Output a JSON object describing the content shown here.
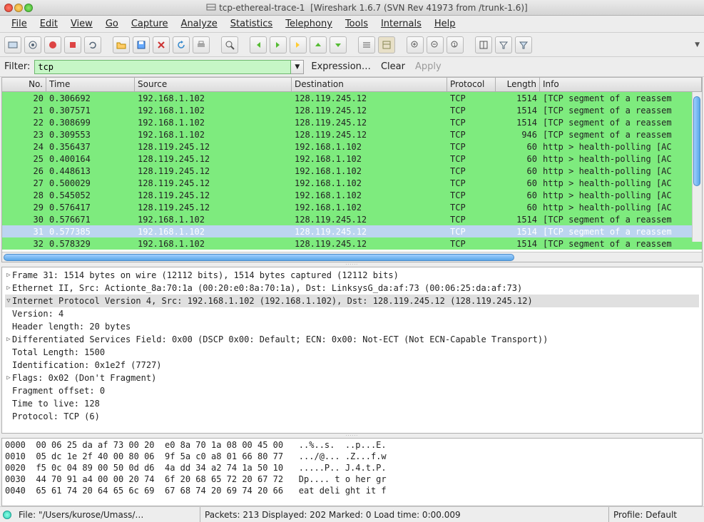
{
  "window": {
    "title_doc": "tcp-ethereal-trace-1",
    "title_app": "[Wireshark 1.6.7  (SVN Rev 41973 from /trunk-1.6)]"
  },
  "menu": {
    "file": "File",
    "edit": "Edit",
    "view": "View",
    "go": "Go",
    "capture": "Capture",
    "analyze": "Analyze",
    "statistics": "Statistics",
    "telephony": "Telephony",
    "tools": "Tools",
    "internals": "Internals",
    "help": "Help"
  },
  "filter": {
    "label": "Filter:",
    "value": "tcp",
    "expression": "Expression…",
    "clear": "Clear",
    "apply": "Apply"
  },
  "columns": {
    "no": "No.",
    "time": "Time",
    "source": "Source",
    "destination": "Destination",
    "protocol": "Protocol",
    "length": "Length",
    "info": "Info"
  },
  "packets": [
    {
      "no": "20",
      "time": "0.306692",
      "src": "192.168.1.102",
      "dst": "128.119.245.12",
      "proto": "TCP",
      "len": "1514",
      "info": "[TCP segment of a reassem",
      "sel": false
    },
    {
      "no": "21",
      "time": "0.307571",
      "src": "192.168.1.102",
      "dst": "128.119.245.12",
      "proto": "TCP",
      "len": "1514",
      "info": "[TCP segment of a reassem",
      "sel": false
    },
    {
      "no": "22",
      "time": "0.308699",
      "src": "192.168.1.102",
      "dst": "128.119.245.12",
      "proto": "TCP",
      "len": "1514",
      "info": "[TCP segment of a reassem",
      "sel": false
    },
    {
      "no": "23",
      "time": "0.309553",
      "src": "192.168.1.102",
      "dst": "128.119.245.12",
      "proto": "TCP",
      "len": "946",
      "info": "[TCP segment of a reassem",
      "sel": false
    },
    {
      "no": "24",
      "time": "0.356437",
      "src": "128.119.245.12",
      "dst": "192.168.1.102",
      "proto": "TCP",
      "len": "60",
      "info": "http > health-polling [AC",
      "sel": false
    },
    {
      "no": "25",
      "time": "0.400164",
      "src": "128.119.245.12",
      "dst": "192.168.1.102",
      "proto": "TCP",
      "len": "60",
      "info": "http > health-polling [AC",
      "sel": false
    },
    {
      "no": "26",
      "time": "0.448613",
      "src": "128.119.245.12",
      "dst": "192.168.1.102",
      "proto": "TCP",
      "len": "60",
      "info": "http > health-polling [AC",
      "sel": false
    },
    {
      "no": "27",
      "time": "0.500029",
      "src": "128.119.245.12",
      "dst": "192.168.1.102",
      "proto": "TCP",
      "len": "60",
      "info": "http > health-polling [AC",
      "sel": false
    },
    {
      "no": "28",
      "time": "0.545052",
      "src": "128.119.245.12",
      "dst": "192.168.1.102",
      "proto": "TCP",
      "len": "60",
      "info": "http > health-polling [AC",
      "sel": false
    },
    {
      "no": "29",
      "time": "0.576417",
      "src": "128.119.245.12",
      "dst": "192.168.1.102",
      "proto": "TCP",
      "len": "60",
      "info": "http > health-polling [AC",
      "sel": false
    },
    {
      "no": "30",
      "time": "0.576671",
      "src": "192.168.1.102",
      "dst": "128.119.245.12",
      "proto": "TCP",
      "len": "1514",
      "info": "[TCP segment of a reassem",
      "sel": false
    },
    {
      "no": "31",
      "time": "0.577385",
      "src": "192.168.1.102",
      "dst": "128.119.245.12",
      "proto": "TCP",
      "len": "1514",
      "info": "[TCP segment of a reassem",
      "sel": true
    },
    {
      "no": "32",
      "time": "0.578329",
      "src": "192.168.1.102",
      "dst": "128.119.245.12",
      "proto": "TCP",
      "len": "1514",
      "info": "[TCP segment of a reassem",
      "sel": false
    }
  ],
  "details": {
    "frame": "Frame 31: 1514 bytes on wire (12112 bits), 1514 bytes captured (12112 bits)",
    "eth": "Ethernet II, Src: Actionte_8a:70:1a (00:20:e0:8a:70:1a), Dst: LinksysG_da:af:73 (00:06:25:da:af:73)",
    "ip": "Internet Protocol Version 4, Src: 192.168.1.102 (192.168.1.102), Dst: 128.119.245.12 (128.119.245.12)",
    "ip_children": [
      "Version: 4",
      "Header length: 20 bytes",
      "Differentiated Services Field: 0x00 (DSCP 0x00: Default; ECN: 0x00: Not-ECT (Not ECN-Capable Transport))",
      "Total Length: 1500",
      "Identification: 0x1e2f (7727)",
      "Flags: 0x02 (Don't Fragment)",
      "Fragment offset: 0",
      "Time to live: 128",
      "Protocol: TCP (6)"
    ]
  },
  "hex": [
    "0000  00 06 25 da af 73 00 20  e0 8a 70 1a 08 00 45 00   ..%..s.  ..p...E.",
    "0010  05 dc 1e 2f 40 00 80 06  9f 5a c0 a8 01 66 80 77   .../@... .Z...f.w",
    "0020  f5 0c 04 89 00 50 0d d6  4a dd 34 a2 74 1a 50 10   .....P.. J.4.t.P.",
    "0030  44 70 91 a4 00 00 20 74  6f 20 68 65 72 20 67 72   Dp.... t o her gr",
    "0040  65 61 74 20 64 65 6c 69  67 68 74 20 69 74 20 66   eat deli ght it f"
  ],
  "status": {
    "file": "File: \"/Users/kurose/Umass/…",
    "packets": "Packets: 213 Displayed: 202 Marked: 0 Load time: 0:00.009",
    "profile": "Profile: Default"
  }
}
